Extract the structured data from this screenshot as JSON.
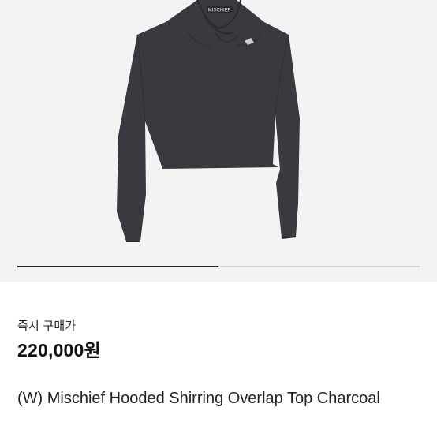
{
  "product": {
    "image_alt": "charcoal hooded shirring overlap top",
    "image_brand_text": "MISCHIEF",
    "image_count": 2,
    "current_image": 1
  },
  "purchase": {
    "price_label": "즉시 구매가",
    "price": "220,000원"
  },
  "product_title": "(W) Mischief Hooded Shirring Overlap Top Charcoal",
  "product_subtitle": "",
  "colors": {
    "garment": "#3a3940",
    "image_bg": "#f3f3f3",
    "indicator_active": "#222222",
    "indicator_track": "#d2d2d2"
  }
}
